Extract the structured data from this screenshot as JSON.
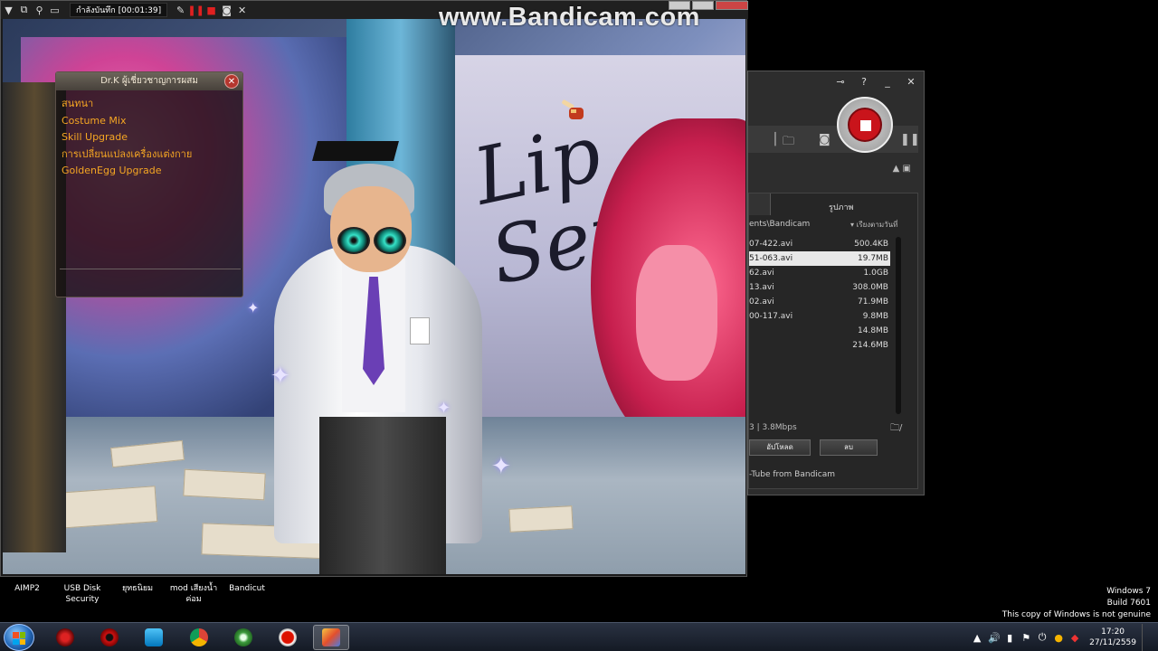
{
  "game_window": {
    "recording_status": "กำลังบันทึก",
    "recording_time": "[00:01:39]"
  },
  "watermark": "www.Bandicam.com",
  "npc_dialog": {
    "title": "Dr.K ผู้เชี่ยวชาญการผสม",
    "close_label": "✕",
    "options": [
      "สนทนา",
      "Costume Mix",
      "Skill Upgrade",
      "การเปลี่ยนแปลงเครื่องแต่งกาย",
      "GoldenEgg Upgrade"
    ]
  },
  "bandicam": {
    "top_icons": [
      "key-icon",
      "help-icon",
      "minimize-icon",
      "close-icon"
    ],
    "top_labels": [
      "⊸",
      "?",
      "_",
      "✕"
    ],
    "tab_images": "รูปภาพ",
    "path": "ents\\Bandicam",
    "sort_label": "▾ เรียงตามวันที่",
    "files": [
      {
        "name": "07-422.avi",
        "size": "500.4KB"
      },
      {
        "name": "51-063.avi",
        "size": "19.7MB"
      },
      {
        "name": "62.avi",
        "size": "1.0GB"
      },
      {
        "name": "13.avi",
        "size": "308.0MB"
      },
      {
        "name": "02.avi",
        "size": "71.9MB"
      },
      {
        "name": "00-117.avi",
        "size": "9.8MB"
      },
      {
        "name": "",
        "size": "14.8MB"
      },
      {
        "name": "",
        "size": "214.6MB"
      }
    ],
    "selected_index": 1,
    "status": "3 | 3.8Mbps",
    "upload_label": "อัปโหลด",
    "delete_label": "ลบ",
    "footer": "-Tube from Bandicam"
  },
  "desktop_icons": [
    {
      "label": "AIMP2"
    },
    {
      "label": "USB Disk\nSecurity"
    },
    {
      "label": "ยุทธนิยม"
    },
    {
      "label": "mod เสียงน้ำ\nค่อม"
    },
    {
      "label": "Bandicut"
    }
  ],
  "windows_notice": {
    "line1": "Windows 7",
    "line2": "Build 7601",
    "line3": "This copy of Windows is not genuine"
  },
  "taskbar": {
    "apps": [
      "ninja-app-icon",
      "red-gear-app-icon",
      "blue-shield-app-icon",
      "chrome-icon",
      "green-app-icon",
      "bandicam-record-icon",
      "game-character-icon"
    ],
    "active_index": 6,
    "clock_time": "17:20",
    "clock_date": "27/11/2559"
  },
  "colors": {
    "npc_option": "#f5a623",
    "record_red": "#c9141b"
  }
}
